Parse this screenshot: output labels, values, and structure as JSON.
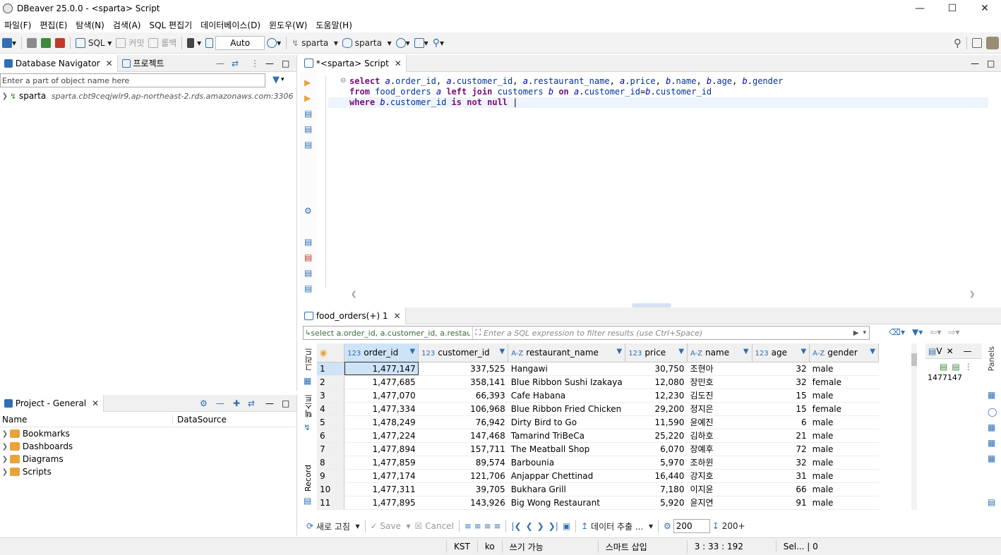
{
  "window": {
    "title": "DBeaver 25.0.0 - <sparta> Script"
  },
  "menu": [
    "파일(F)",
    "편집(E)",
    "탐색(N)",
    "검색(A)",
    "SQL 편집기",
    "데이터베이스(D)",
    "윈도우(W)",
    "도움말(H)"
  ],
  "toolbar": {
    "sql_label": "SQL",
    "commit_label": "커밋",
    "rollback_label": "롤백",
    "auto_label": "Auto",
    "datasource_label": "sparta",
    "schema_label": "sparta"
  },
  "navigator": {
    "tab_label": "Database Navigator",
    "project_tab_label": "프로젝트",
    "filter_placeholder": "Enter a part of object name here",
    "connection_name": "sparta",
    "connection_host": "sparta.cbt9ceqjwlr9.ap-northeast-2.rds.amazonaws.com:3306"
  },
  "project": {
    "tab_label": "Project - General",
    "col_name": "Name",
    "col_datasource": "DataSource",
    "items": [
      "Bookmarks",
      "Dashboards",
      "Diagrams",
      "Scripts"
    ]
  },
  "editor": {
    "tab_label": "*<sparta> Script",
    "lines": [
      "select a.order_id, a.customer_id, a.restaurant_name, a.price, b.name, b.age, b.gender",
      "from food_orders a left join customers b on a.customer_id=b.customer_id",
      "where b.customer_id is not null "
    ]
  },
  "results": {
    "tab_label": "food_orders(+) 1",
    "query_preview": "select a.order_id, a.customer_id, a.restaura",
    "filter_placeholder": "Enter a SQL expression to filter results (use Ctrl+Space)",
    "grid_side_label": "그리드",
    "text_side_label": "텍스트",
    "record_side_label": "Record",
    "columns": [
      {
        "type": "123",
        "name": "order_id"
      },
      {
        "type": "123",
        "name": "customer_id"
      },
      {
        "type": "A-Z",
        "name": "restaurant_name"
      },
      {
        "type": "123",
        "name": "price"
      },
      {
        "type": "A-Z",
        "name": "name"
      },
      {
        "type": "123",
        "name": "age"
      },
      {
        "type": "A-Z",
        "name": "gender"
      }
    ],
    "rows": [
      [
        "1",
        "1,477,147",
        "337,525",
        "Hangawi",
        "30,750",
        "조현아",
        "32",
        "male"
      ],
      [
        "2",
        "1,477,685",
        "358,141",
        "Blue Ribbon Sushi Izakaya",
        "12,080",
        "장민호",
        "32",
        "female"
      ],
      [
        "3",
        "1,477,070",
        "66,393",
        "Cafe Habana",
        "12,230",
        "김도진",
        "15",
        "male"
      ],
      [
        "4",
        "1,477,334",
        "106,968",
        "Blue Ribbon Fried Chicken",
        "29,200",
        "정지은",
        "15",
        "female"
      ],
      [
        "5",
        "1,478,249",
        "76,942",
        "Dirty Bird to Go",
        "11,590",
        "윤예진",
        "6",
        "male"
      ],
      [
        "6",
        "1,477,224",
        "147,468",
        "Tamarind TriBeCa",
        "25,220",
        "김하호",
        "21",
        "male"
      ],
      [
        "7",
        "1,477,894",
        "157,711",
        "The Meatball Shop",
        "6,070",
        "장예후",
        "72",
        "male"
      ],
      [
        "8",
        "1,477,859",
        "89,574",
        "Barbounia",
        "5,970",
        "조하윈",
        "32",
        "male"
      ],
      [
        "9",
        "1,477,174",
        "121,706",
        "Anjappar Chettinad",
        "16,440",
        "강지호",
        "31",
        "male"
      ],
      [
        "10",
        "1,477,311",
        "39,705",
        "Bukhara Grill",
        "7,180",
        "이지윤",
        "66",
        "male"
      ],
      [
        "11",
        "1,477,895",
        "143,926",
        "Big Wong Restaurant",
        "5,920",
        "윤지연",
        "91",
        "male"
      ]
    ],
    "value_panel": {
      "tab_label": "V",
      "value": "1477147",
      "panels_label": "Panels"
    },
    "bottom": {
      "refresh_label": "새로 고침",
      "save_label": "Save",
      "cancel_label": "Cancel",
      "export_label": "데이터 추출 ...",
      "fetch_size": "200",
      "fetch_more_label": "200+"
    }
  },
  "status": {
    "timezone": "KST",
    "locale": "ko",
    "mode": "쓰기 가능",
    "insert_mode": "스마트 삽입",
    "position": "3 : 33 : 192",
    "selection": "Sel... | 0"
  }
}
